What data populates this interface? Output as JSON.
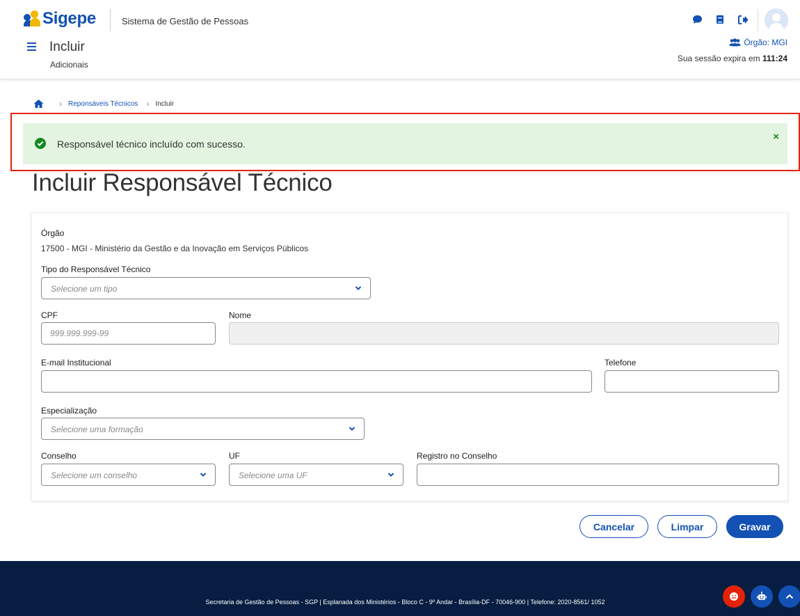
{
  "header": {
    "logo_text": "Sigepe",
    "system_name": "Sistema de Gestão de Pessoas",
    "page_title": "Incluir",
    "page_subtitle": "Adicionais",
    "icons": [
      "chat-icon",
      "book-icon",
      "logout-icon",
      "user-avatar"
    ],
    "orgao_label": "Órgão: MGI",
    "session_text": "Sua sessão expira em",
    "session_time": "111:24"
  },
  "breadcrumb": {
    "items": [
      "Reponsáveis Técnicos",
      "Incluir"
    ]
  },
  "alert": {
    "message": "Responsável técnico incluído com sucesso.",
    "close_label": "×"
  },
  "form": {
    "title": "Incluir Responsável Técnico",
    "orgao_label": "Órgão",
    "orgao_value": "17500 - MGI - Ministério da Gestão e da Inovação em Serviços Públicos",
    "tipo_label": "Tipo do Responsável Técnico",
    "tipo_placeholder": "Selecione um tipo",
    "cpf_label": "CPF",
    "cpf_placeholder": "999.999.999-99",
    "nome_label": "Nome",
    "email_label": "E-mail Institucional",
    "telefone_label": "Telefone",
    "especializacao_label": "Especialização",
    "especializacao_placeholder": "Selecione uma formação",
    "conselho_label": "Conselho",
    "conselho_placeholder": "Selecione um conselho",
    "uf_label": "UF",
    "uf_placeholder": "Selecione uma UF",
    "registro_label": "Registro no Conselho"
  },
  "actions": {
    "cancel": "Cancelar",
    "clear": "Limpar",
    "save": "Gravar"
  },
  "footer": {
    "text": "Secretaria de Gestão de Pessoas - SGP | Esplanada dos Ministérios - Bloco C - 9º Andar - Brasília-DF - 70046-900 | Telefone: 2020-8561/ 1052"
  },
  "colors": {
    "primary": "#1351b4",
    "success_bg": "#e3f5e1",
    "success": "#168821",
    "highlight_border": "#e52207",
    "footer_bg": "#071d41"
  }
}
